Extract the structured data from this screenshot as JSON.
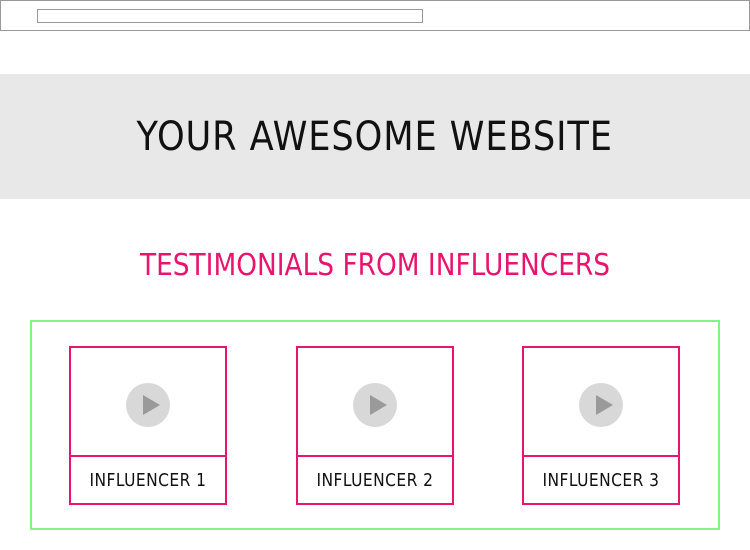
{
  "header": {
    "site_title": "YOUR AWESOME WEBSITE"
  },
  "testimonials": {
    "title": "TESTIMONIALS FROM INFLUENCERS",
    "items": [
      {
        "label": "INFLUENCER 1",
        "icon": "play-icon"
      },
      {
        "label": "INFLUENCER 2",
        "icon": "play-icon"
      },
      {
        "label": "INFLUENCER 3",
        "icon": "play-icon"
      }
    ]
  },
  "colors": {
    "accent": "#e8146e",
    "panel_border": "#84f384",
    "hero_background": "#e8e8e8",
    "play_button": "#d8d8d8"
  }
}
